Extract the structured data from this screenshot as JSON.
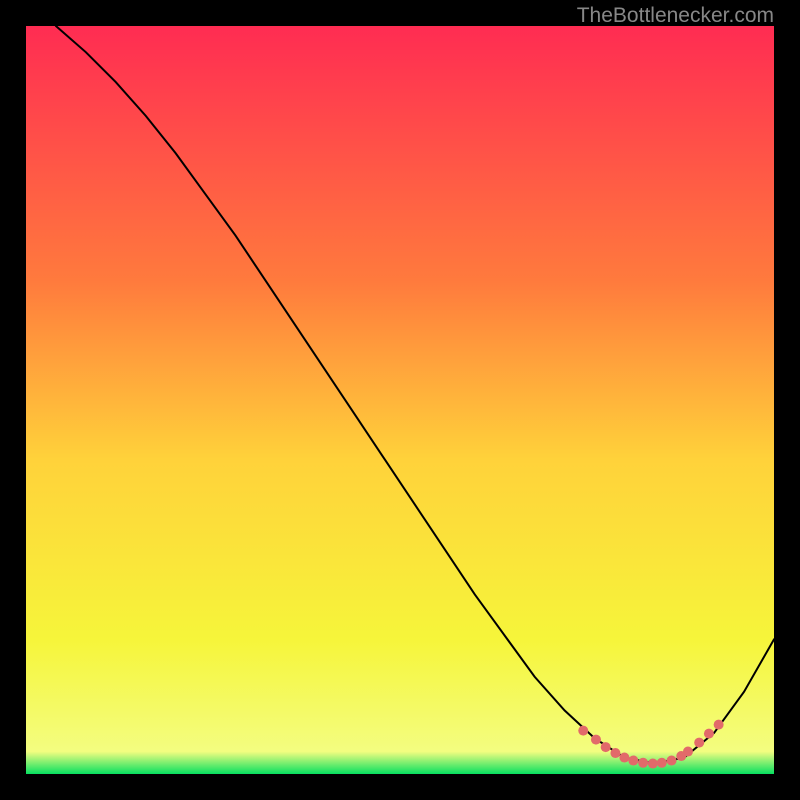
{
  "watermark": "TheBottlenecker.com",
  "chart_data": {
    "type": "line",
    "title": "",
    "xlabel": "",
    "ylabel": "",
    "xlim": [
      0,
      100
    ],
    "ylim": [
      0,
      100
    ],
    "background_gradient": {
      "top_color": "#ff2c52",
      "mid_upper": "#ff7a3d",
      "mid": "#ffd23a",
      "mid_lower": "#f6f53a",
      "bottom_color": "#07e060"
    },
    "series": [
      {
        "name": "curve",
        "color": "#000000",
        "stroke_width": 2,
        "x": [
          4,
          8,
          12,
          16,
          20,
          24,
          28,
          32,
          36,
          40,
          44,
          48,
          52,
          56,
          60,
          64,
          68,
          72,
          76,
          80,
          84,
          88,
          92,
          96,
          100
        ],
        "y": [
          100,
          96.5,
          92.5,
          88,
          83,
          77.5,
          72,
          66,
          60,
          54,
          48,
          42,
          36,
          30,
          24,
          18.5,
          13,
          8.5,
          4.8,
          2.2,
          1.4,
          2.2,
          5.5,
          11,
          18
        ]
      },
      {
        "name": "bottleneck-highlight",
        "type": "scatter",
        "color": "#e26a6a",
        "marker_radius": 5,
        "x": [
          74.5,
          76.2,
          77.5,
          78.8,
          80.0,
          81.2,
          82.5,
          83.8,
          85.0,
          86.3,
          87.6,
          88.5,
          90.0,
          91.3,
          92.6
        ],
        "y": [
          5.8,
          4.6,
          3.6,
          2.8,
          2.2,
          1.8,
          1.5,
          1.4,
          1.5,
          1.8,
          2.4,
          3.0,
          4.2,
          5.4,
          6.6
        ]
      }
    ]
  }
}
